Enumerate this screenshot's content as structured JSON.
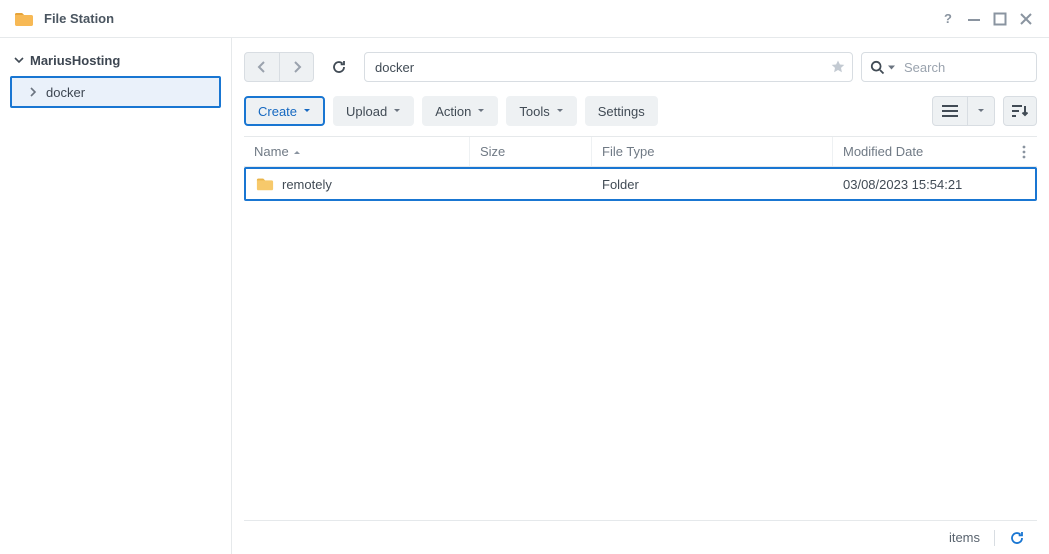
{
  "window": {
    "title": "File Station"
  },
  "sidebar": {
    "root": "MariusHosting",
    "child": "docker"
  },
  "nav": {
    "path": "docker",
    "search_placeholder": "Search"
  },
  "toolbar": {
    "create": "Create",
    "upload": "Upload",
    "action": "Action",
    "tools": "Tools",
    "settings": "Settings"
  },
  "columns": {
    "name": "Name",
    "size": "Size",
    "type": "File Type",
    "date": "Modified Date"
  },
  "rows": [
    {
      "name": "remotely",
      "size": "",
      "type": "Folder",
      "date": "03/08/2023 15:54:21"
    }
  ],
  "status": {
    "items_label": "items"
  }
}
